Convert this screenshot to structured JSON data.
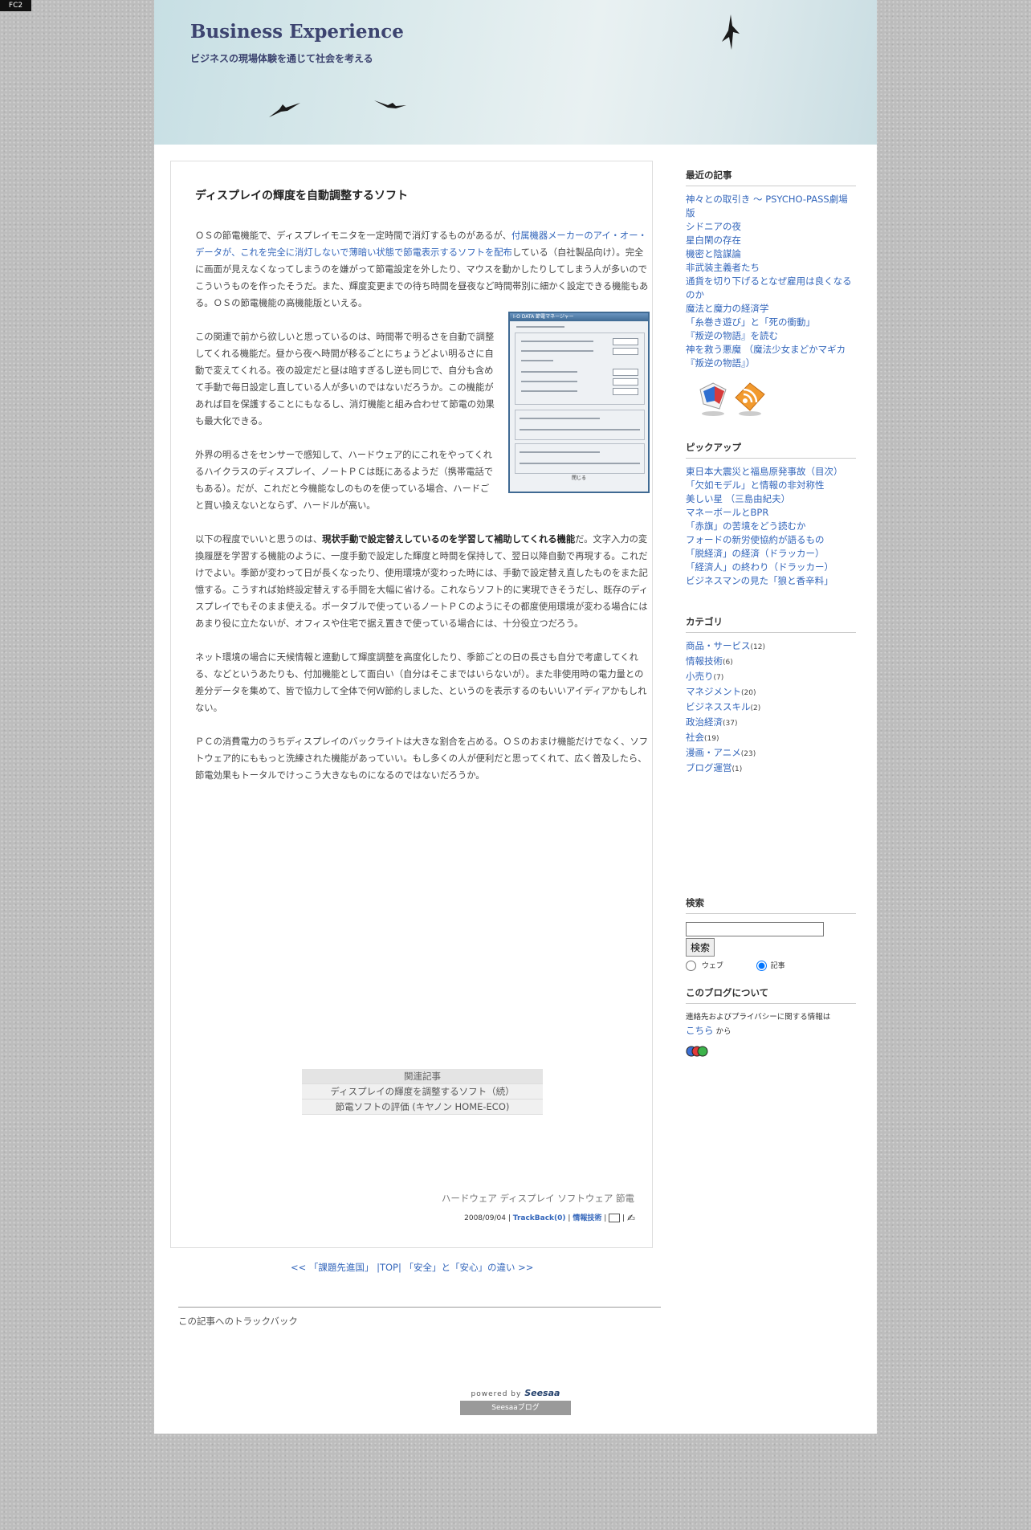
{
  "fc2_badge": "FC2",
  "blog": {
    "title": "Business Experience",
    "subtitle": "ビジネスの現場体験を通じて社会を考える"
  },
  "post": {
    "title": "ディスプレイの輝度を自動調整するソフト",
    "p1_a": "ＯＳの節電機能で、ディスプレイモニタを一定時間で消灯するものがあるが、",
    "p1_link": "付属機器メーカーのアイ・オー・データが、これを完全に消灯しないで薄暗い状態で節電表示するソフトを配布",
    "p1_b": "している（自社製品向け）。完全に画面が見えなくなってしまうのを嫌がって節電設定を外したり、マウスを動かしたりしてしまう人が多いのでこういうものを作ったそうだ。また、輝度変更までの待ち時間を昼夜など時間帯別に細かく設定できる機能もある。ＯＳの節電機能の高機能版といえる。",
    "p2": "この関連で前から欲しいと思っているのは、時間帯で明るさを自動で調整してくれる機能だ。昼から夜へ時間が移るごとにちょうどよい明るさに自動で変えてくれる。夜の設定だと昼は暗すぎるし逆も同じで、自分も含めて手動で毎日設定し直している人が多いのではないだろうか。この機能があれば目を保護することにもなるし、消灯機能と組み合わせて節電の効果も最大化できる。",
    "p3": "外界の明るさをセンサーで感知して、ハードウェア的にこれをやってくれるハイクラスのディスプレイ、ノートＰＣは既にあるようだ（携帯電話でもある）。だが、これだと今機能なしのものを使っている場合、ハードごと買い換えないとならず、ハードルが高い。",
    "p4_a": "以下の程度でいいと思うのは、",
    "p4_bold": "現状手動で設定替えしているのを学習して補助してくれる機能",
    "p4_b": "だ。文字入力の変換履歴を学習する機能のように、一度手動で設定した輝度と時間を保持して、翌日以降自動で再現する。これだけでよい。季節が変わって日が長くなったり、使用環境が変わった時には、手動で設定替え直したものをまた記憶する。こうすれば始終設定替えする手間を大幅に省ける。これならソフト的に実現できそうだし、既存のディスプレイでもそのまま使える。ポータブルで使っているノートＰＣのようにその都度使用環境が変わる場合にはあまり役に立たないが、オフィスや住宅で据え置きで使っている場合には、十分役立つだろう。",
    "p5": "ネット環境の場合に天候情報と連動して輝度調整を高度化したり、季節ごとの日の長さも自分で考慮してくれる、などというあたりも、付加機能として面白い（自分はそこまではいらないが）。また非使用時の電力量との差分データを集めて、皆で協力して全体で何Ｗ節約しました、というのを表示するのもいいアイディアかもしれない。",
    "p6": "ＰＣの消費電力のうちディスプレイのバックライトは大きな割合を占める。ＯＳのおまけ機能だけでなく、ソフトウェア的にももっと洗練された機能があっていい。もし多くの人が便利だと思ってくれて、広く普及したら、節電効果もトータルでけっこう大きなものになるのではないだろうか。",
    "screenshot_title": "I-O DATA 節電マネージャー",
    "screenshot_close": "閉じる",
    "related_header": "関連記事",
    "related": [
      "ディスプレイの輝度を調整するソフト（続）",
      "節電ソフトの評価 (キヤノン HOME-ECO)"
    ],
    "tags": "ハードウェア ディスプレイ ソフトウェア 節電",
    "date": "2008/09/04",
    "sep": "|",
    "trackback": "TrackBack(0)",
    "category": "情報技術"
  },
  "nav": {
    "prev": "<< 「課題先進国」",
    "top": "|TOP|",
    "next": "「安全」と「安心」の違い >>"
  },
  "trackback_title": "この記事へのトラックバック",
  "footer": {
    "powered": "powered by",
    "brand": "Seesaa",
    "blog": "Seesaaブログ"
  },
  "sidebar": {
    "recent_title": "最近の記事",
    "recent": [
      "神々との取引き ～ PSYCHO-PASS劇場版",
      "シドニアの夜",
      "星白閑の存在",
      "機密と陰謀論",
      "非武装主義者たち",
      "通貨を切り下げるとなぜ雇用は良くなるのか",
      "魔法と魔力の経済学",
      "「糸巻き遊び」と「死の衝動」",
      "『叛逆の物語』を読む",
      "神を救う悪魔 （魔法少女まどかマギカ『叛逆の物語』）"
    ],
    "pickup_title": "ピックアップ",
    "pickup": [
      "東日本大震災と福島原発事故（目次）",
      "「欠如モデル」と情報の非対称性",
      "美しい星 （三島由紀夫）",
      "マネーボールとBPR",
      "「赤旗」の苦境をどう読むか",
      "フォードの新労使協約が語るもの",
      "「脱経済」の経済（ドラッカー）",
      "「経済人」の終わり（ドラッカー）",
      "ビジネスマンの見た「狼と香辛料」"
    ],
    "category_title": "カテゴリ",
    "categories": [
      {
        "name": "商品・サービス",
        "count": "(12)"
      },
      {
        "name": "情報技術",
        "count": "(6)"
      },
      {
        "name": "小売り",
        "count": "(7)"
      },
      {
        "name": "マネジメント",
        "count": "(20)"
      },
      {
        "name": "ビジネススキル",
        "count": "(2)"
      },
      {
        "name": "政治経済",
        "count": "(37)"
      },
      {
        "name": "社会",
        "count": "(19)"
      },
      {
        "name": "漫画・アニメ",
        "count": "(23)"
      },
      {
        "name": "ブログ運営",
        "count": "(1)"
      }
    ],
    "search_title": "検索",
    "search_value": "",
    "search_button": "検索",
    "radio_web": "ウェブ",
    "radio_blog": "記事",
    "about_title": "このブログについて",
    "about_text": "連絡先およびプライバシーに関する情報は",
    "about_link": "こちら",
    "about_suffix": "から"
  },
  "colors": {
    "link": "#3366bb",
    "title": "#3d4470",
    "background": "#bdbdbd"
  }
}
